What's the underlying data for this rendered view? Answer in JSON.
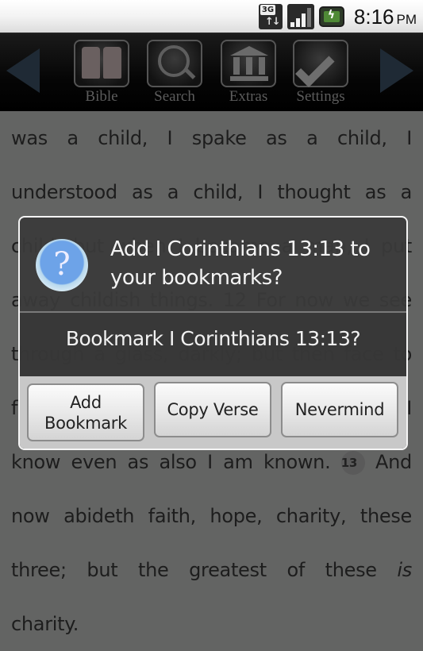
{
  "status_bar": {
    "network_label": "3G",
    "time": "8:16",
    "ampm": "PM",
    "icons": [
      "3g-data-icon",
      "signal-strength-icon",
      "battery-charging-icon"
    ]
  },
  "toolbar": {
    "prev_label": "previous",
    "next_label": "next",
    "items": [
      {
        "label": "Bible",
        "icon": "book-icon"
      },
      {
        "label": "Search",
        "icon": "magnifier-icon"
      },
      {
        "label": "Extras",
        "icon": "building-icon"
      },
      {
        "label": "Settings",
        "icon": "checkmark-icon"
      }
    ]
  },
  "reader": {
    "lines": [
      "was a child, I spake as a child, I",
      "understood as a child, I thought as a",
      "child: but when I became a man, I put",
      "away childish things. 12 For now we see",
      "through a glass, darkly; but then face to",
      "face: now I know in part; but then shall I",
      "know even as also I am known.",
      "now abideth faith, hope, charity, these",
      "three; but the greatest of these",
      "charity."
    ],
    "verse_number": "13",
    "line7_tail": "And",
    "italic_word": "is"
  },
  "dialog": {
    "title": "Add I Corinthians 13:13 to your bookmarks?",
    "message": "Bookmark I Corinthians 13:13?",
    "icon": "question-icon",
    "buttons": {
      "add": "Add Bookmark",
      "copy": "Copy Verse",
      "cancel": "Nevermind"
    }
  }
}
